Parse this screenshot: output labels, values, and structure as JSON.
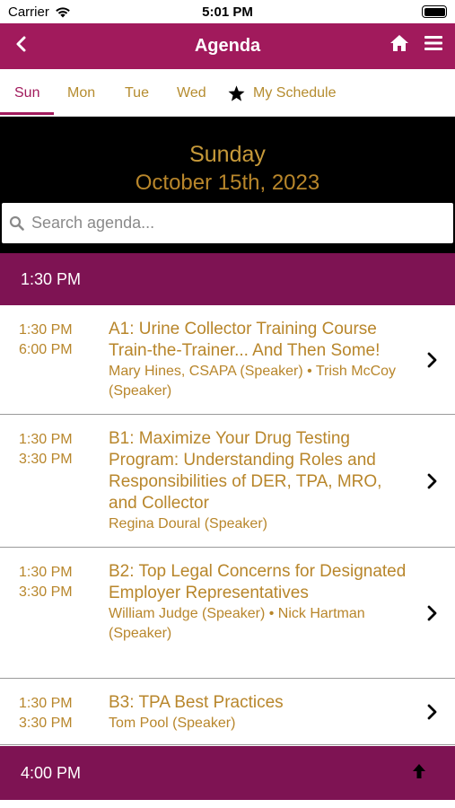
{
  "status_bar": {
    "carrier": "Carrier",
    "time": "5:01 PM"
  },
  "header": {
    "title": "Agenda",
    "color": "#a11a5c",
    "icons": [
      "back-chevron-icon",
      "home-icon",
      "menu-icon"
    ]
  },
  "tabs": [
    {
      "label": "Sun",
      "active": true
    },
    {
      "label": "Mon",
      "active": false
    },
    {
      "label": "Tue",
      "active": false
    },
    {
      "label": "Wed",
      "active": false
    },
    {
      "label": "My Schedule",
      "active": false,
      "icon": "star-icon"
    }
  ],
  "date_banner": {
    "day": "Sunday",
    "date": "October 15th, 2023"
  },
  "search": {
    "placeholder": "Search agenda..."
  },
  "sections": [
    {
      "time": "1:30 PM",
      "sessions": [
        {
          "start": "1:30 PM",
          "end": "6:00 PM",
          "title": "A1: Urine Collector Training Course Train-the-Trainer... And Then Some!",
          "speakers": "Mary Hines, CSAPA (Speaker) • Trish McCoy (Speaker)"
        },
        {
          "start": "1:30 PM",
          "end": "3:30 PM",
          "title": "B1: Maximize Your Drug Testing Program: Understanding Roles and Responsibilities of DER, TPA, MRO, and Collector",
          "speakers": "Regina Doural (Speaker)"
        },
        {
          "start": "1:30 PM",
          "end": "3:30 PM",
          "title": "B2: Top Legal Concerns for Designated Employer Representatives",
          "speakers": "William Judge (Speaker) • Nick Hartman (Speaker)"
        },
        {
          "start": "1:30 PM",
          "end": "3:30 PM",
          "title": "B3: TPA Best Practices",
          "speakers": "Tom Pool (Speaker)"
        }
      ]
    },
    {
      "time": "4:00 PM",
      "sessions": []
    }
  ],
  "colors": {
    "primary": "#a11a5c",
    "section_header": "#7e1353",
    "gold": "#b8862b"
  }
}
